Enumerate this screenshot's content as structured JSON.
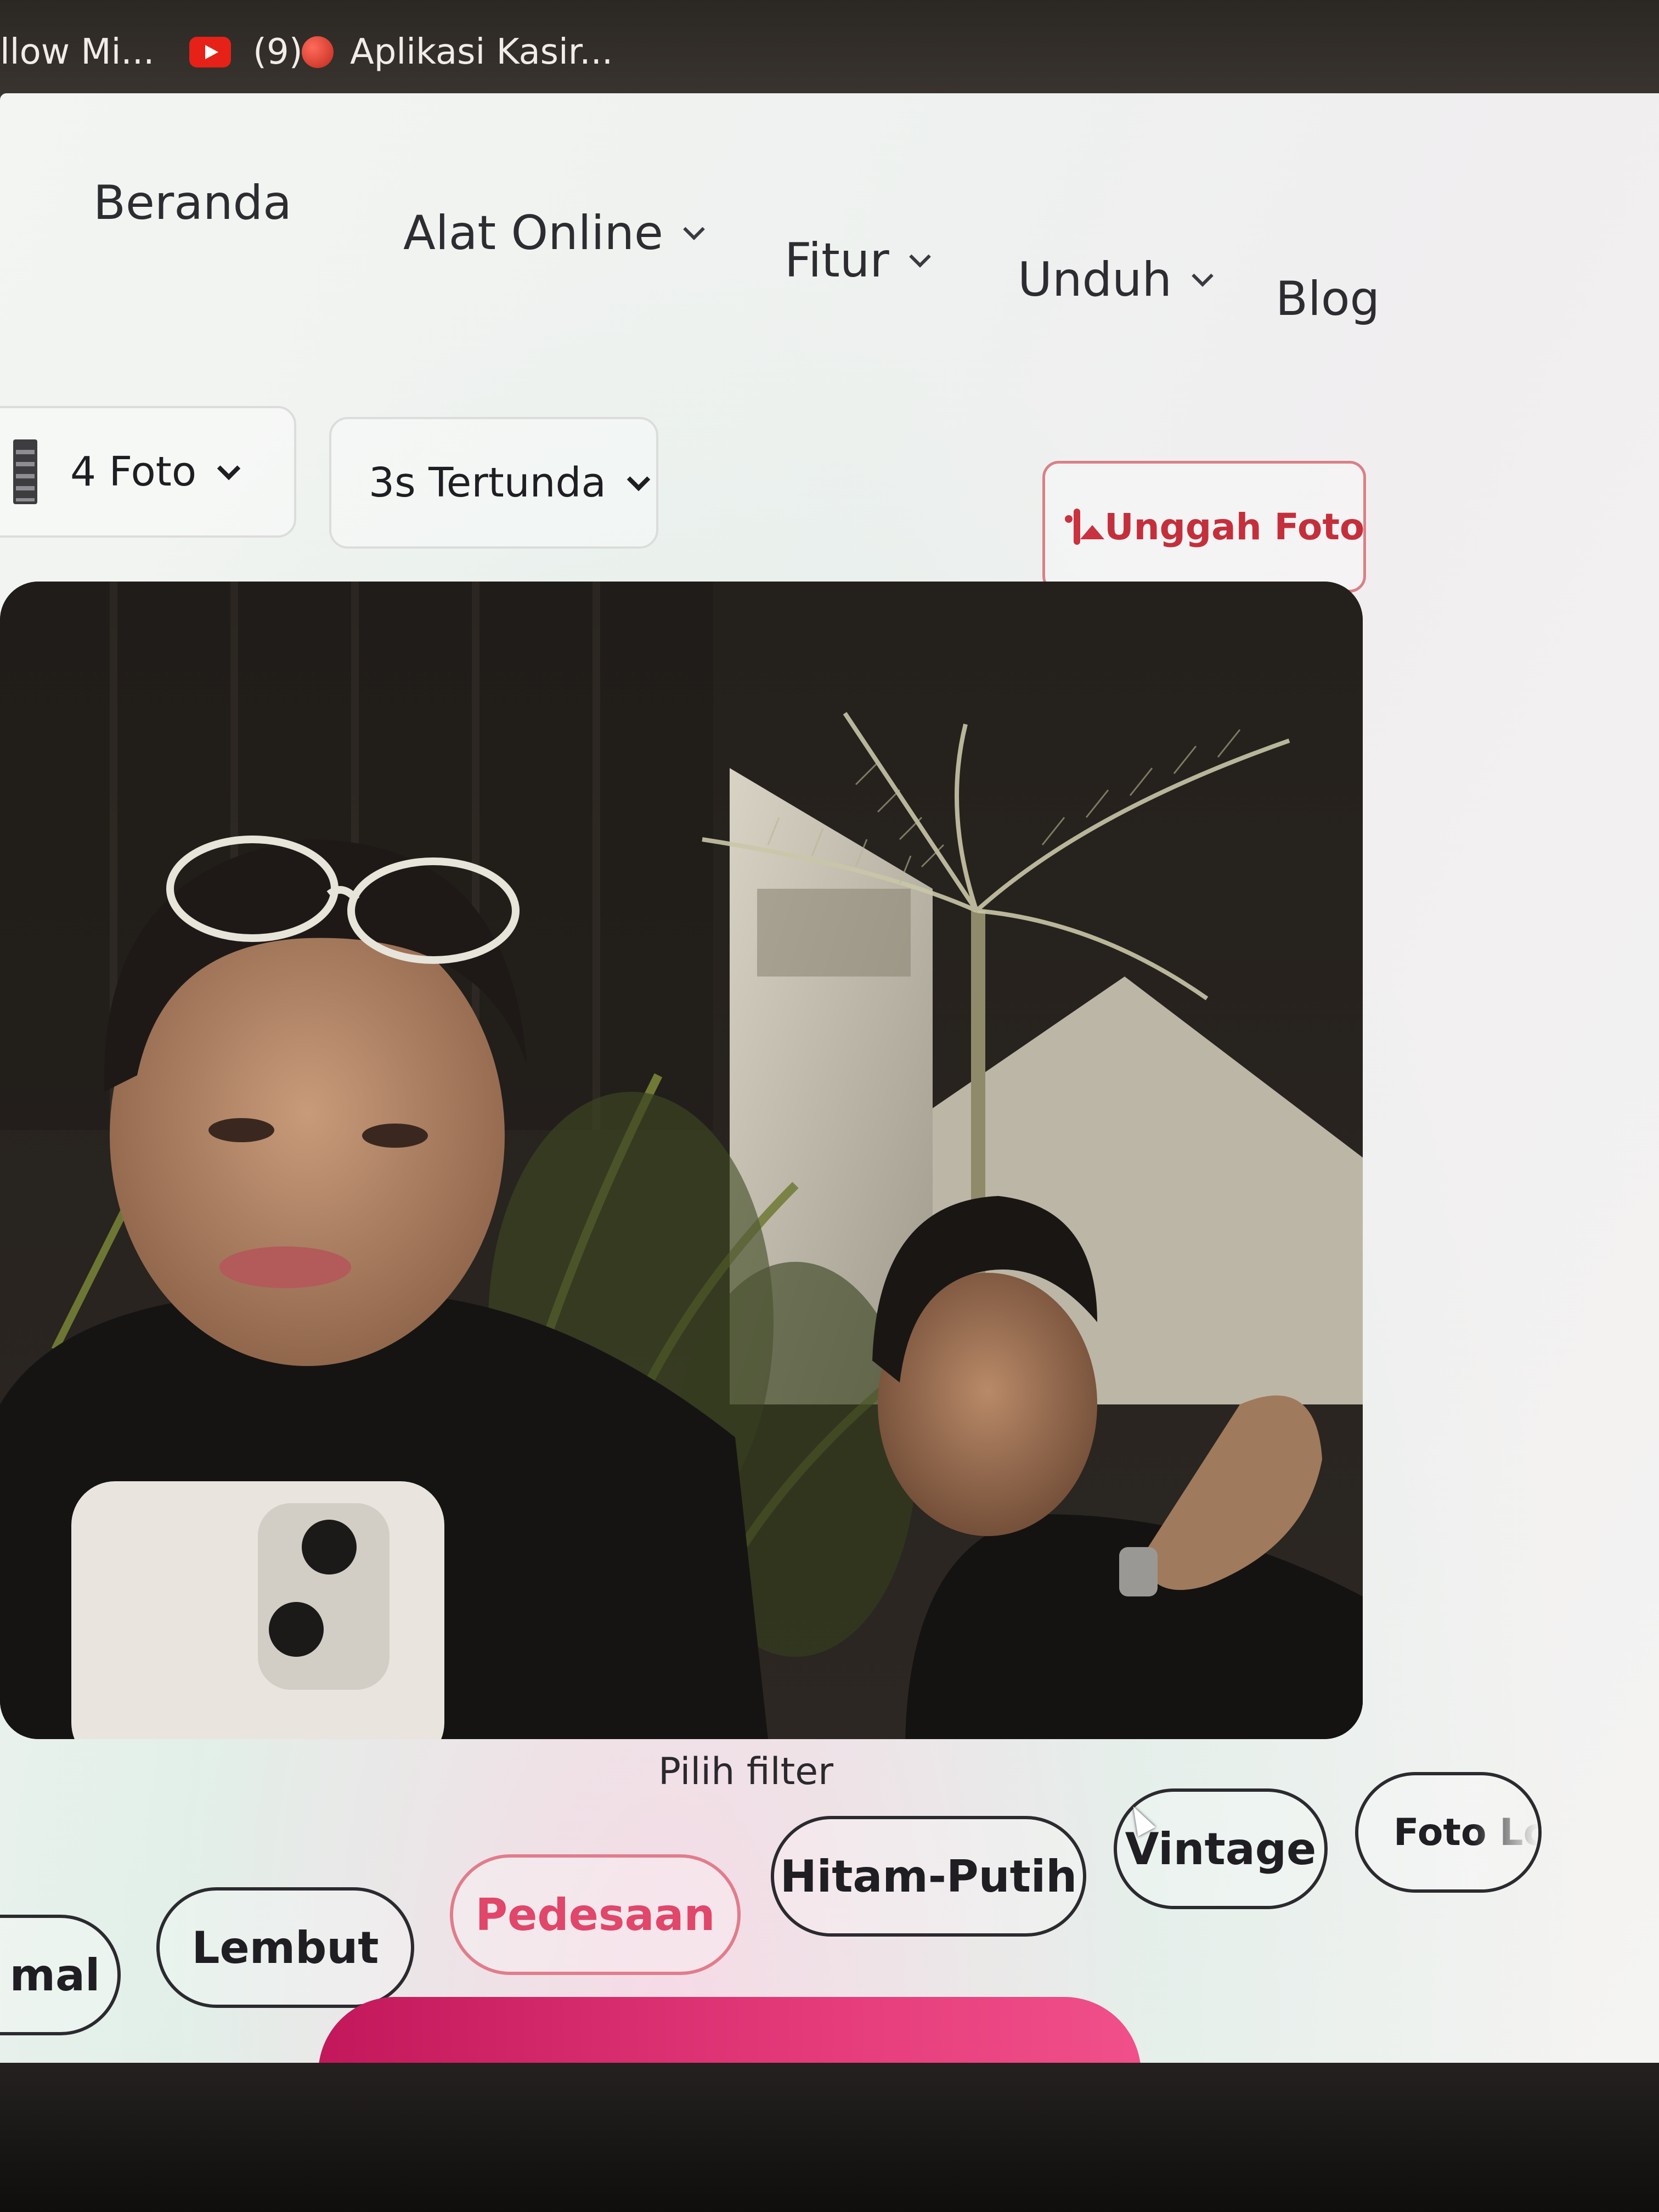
{
  "bookmarks": {
    "item1_label": "llow Mi...",
    "item2_label": "(9)",
    "item3_label": "Aplikasi Kasir..."
  },
  "nav": {
    "home": "Beranda",
    "online_tools": "Alat Online",
    "features": "Fitur",
    "download": "Unduh",
    "blog": "Blog"
  },
  "controls": {
    "photo_count": "4 Foto",
    "delay": "3s Tertunda",
    "upload": "Unggah Foto"
  },
  "filters": {
    "title": "Pilih filter",
    "items": [
      {
        "label": "mal",
        "active": false
      },
      {
        "label": "Lembut",
        "active": false
      },
      {
        "label": "Pedesaan",
        "active": true
      },
      {
        "label": "Hitam-Putih",
        "active": false
      },
      {
        "label": "Vintage",
        "active": false
      },
      {
        "label": "Foto Lc",
        "active": false
      }
    ]
  },
  "colors": {
    "accent": "#e0476a",
    "upload_accent": "#c42f3c",
    "capture_button": "#e53a7a",
    "text_dark": "#2d2c31"
  },
  "icons": {
    "bookmark2": "youtube-icon",
    "bookmark3": "red-circle-icon",
    "photo_count": "filmstrip-icon",
    "upload": "image-icon",
    "dropdown": "chevron-down-icon"
  }
}
